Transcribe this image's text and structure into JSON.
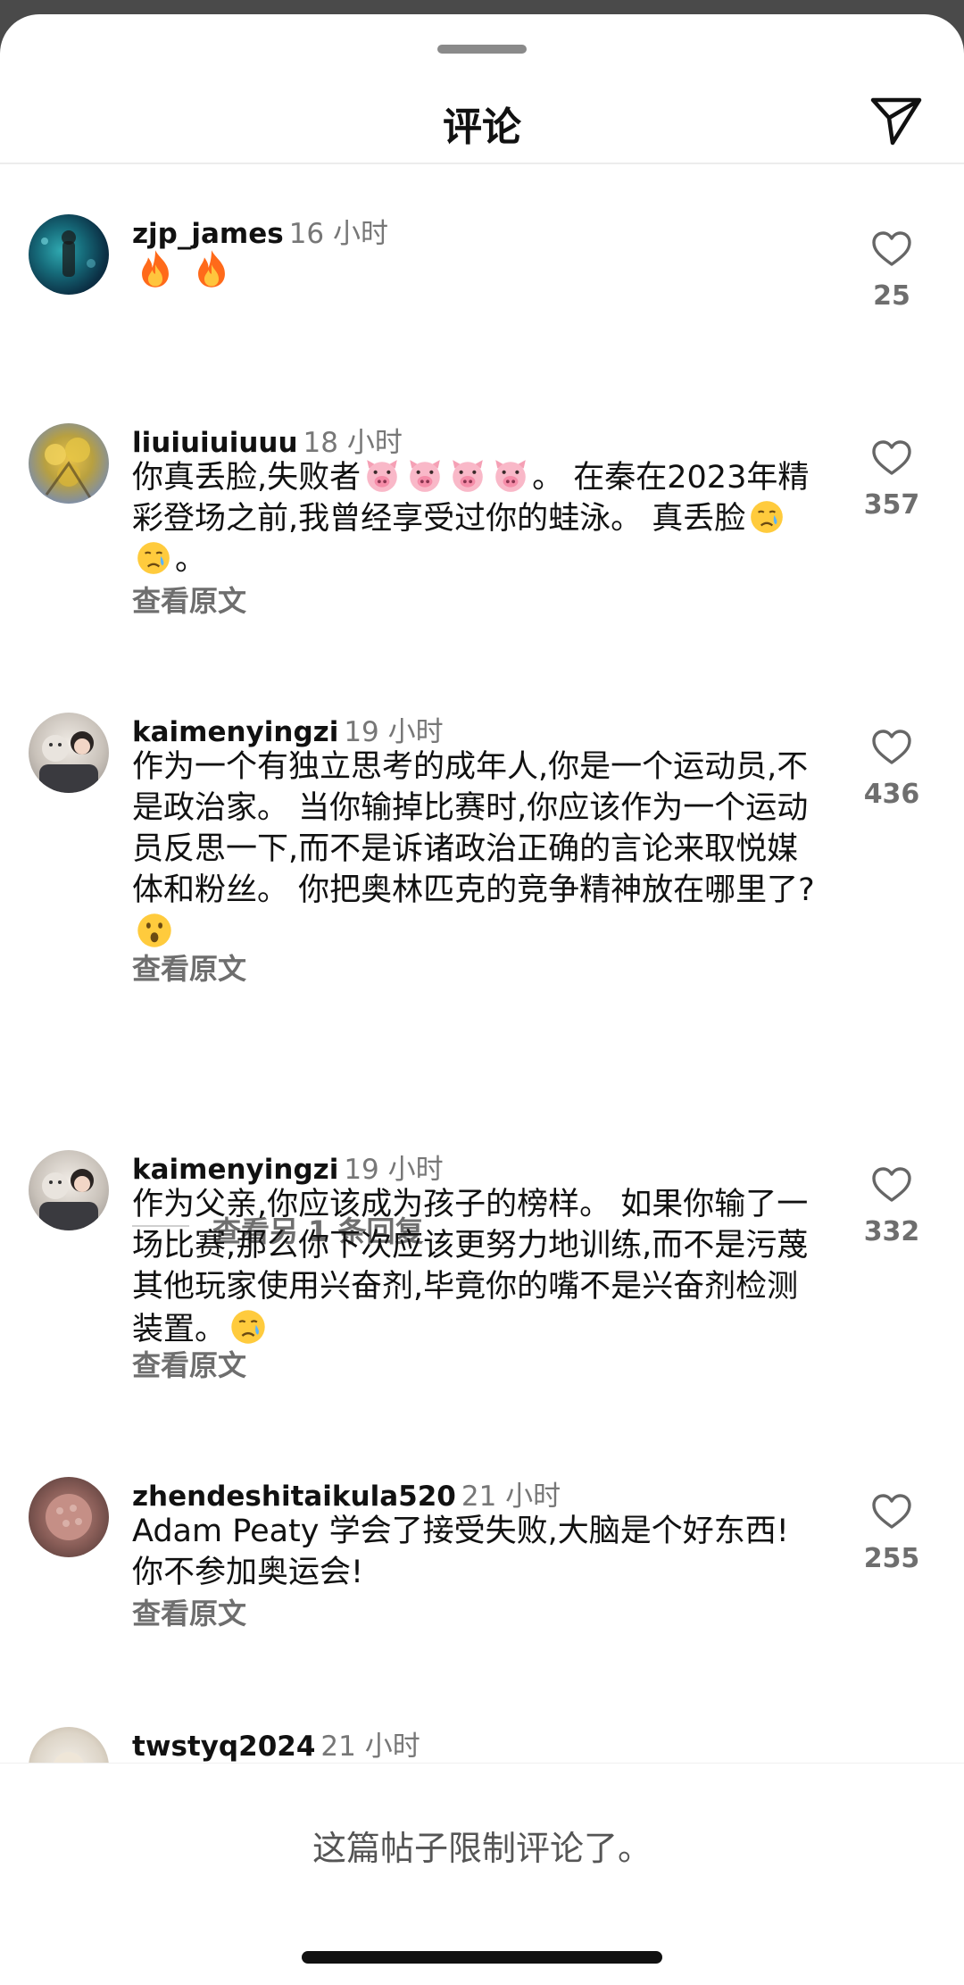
{
  "header": {
    "title": "评论"
  },
  "comments": [
    {
      "user": "zjp_james",
      "time": "16 小时",
      "text": "",
      "likes": "25",
      "translate": ""
    },
    {
      "user": "liuiuiuiuuu",
      "time": "18 小时",
      "text_a": "你真丢脸,失败者",
      "text_b": "。 在秦在2023年精彩登场之前,我曾经享受过你的蛙泳。 真丢脸",
      "text_c": "。",
      "likes": "357",
      "translate": "查看原文"
    },
    {
      "user": "kaimenyingzi",
      "time": "19 小时",
      "text": "作为一个有独立思考的成年人,你是一个运动员,不是政治家。 当你输掉比赛时,你应该作为一个运动员反思一下,而不是诉诸政治正确的言论来取悦媒体和粉丝。 你把奥林匹克的竞争精神放在哪里了?",
      "likes": "436",
      "translate": "查看原文"
    },
    {
      "user": "kaimenyingzi",
      "time": "19 小时",
      "text": "作为父亲,你应该成为孩子的榜样。 如果你输了一场比赛,那么你下次应该更努力地训练,而不是污蔑其他玩家使用兴奋剂,毕竟你的嘴不是兴奋剂检测装置。",
      "likes": "332",
      "translate": "查看原文"
    },
    {
      "user": "zhendeshitaikula520",
      "time": "21 小时",
      "text": "Adam Peaty 学会了接受失败,大脑是个好东西! 你不参加奥运会!",
      "likes": "255",
      "translate": "查看原文"
    },
    {
      "user": "twstyq2024",
      "time": "21 小时"
    }
  ],
  "replies": {
    "label": "查看另 1 条回复"
  },
  "footer": {
    "text": "这篇帖子限制评论了。"
  },
  "icons": {
    "send": "send-icon",
    "like": "heart-icon",
    "fire": "fire-emoji",
    "pig": "pig-face-emoji",
    "cry": "crying-face-emoji",
    "surprise": "surprised-face-emoji"
  }
}
